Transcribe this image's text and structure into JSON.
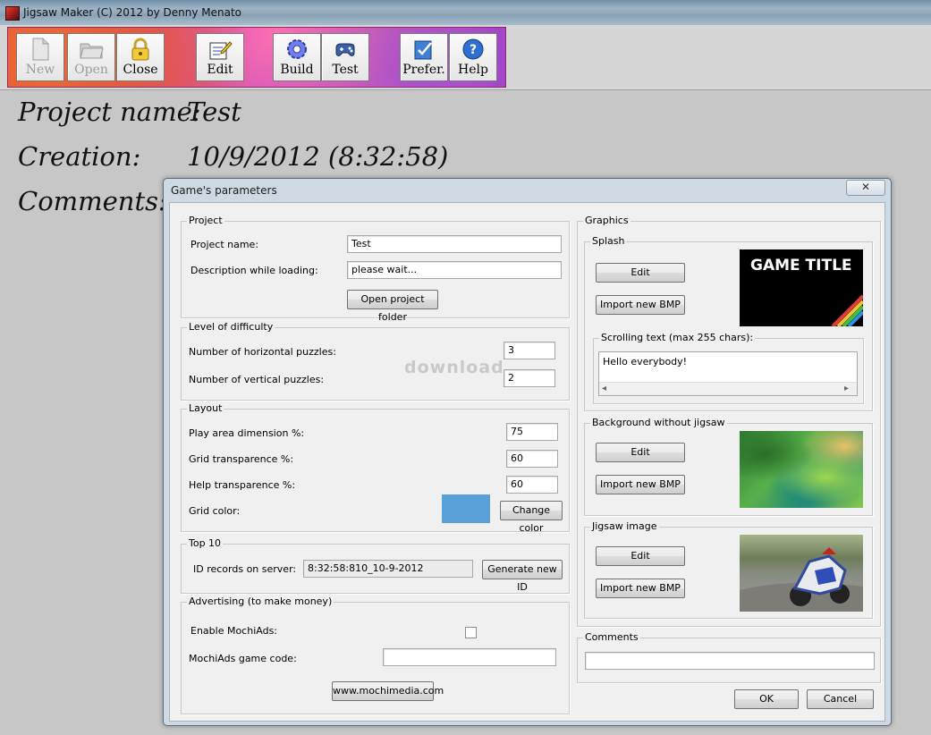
{
  "window": {
    "title": "Jigsaw Maker (C) 2012 by Denny Menato"
  },
  "toolbar": {
    "buttons": [
      {
        "label": "New",
        "icon": "new-document-icon",
        "enabled": false
      },
      {
        "label": "Open",
        "icon": "open-folder-icon",
        "enabled": false
      },
      {
        "label": "Close",
        "icon": "padlock-icon",
        "enabled": true
      },
      {
        "label": "Edit",
        "icon": "edit-pen-icon",
        "enabled": true
      },
      {
        "label": "Build",
        "icon": "gear-icon",
        "enabled": true
      },
      {
        "label": "Test",
        "icon": "gamepad-icon",
        "enabled": true
      },
      {
        "label": "Prefer.",
        "icon": "preferences-check-icon",
        "enabled": true
      },
      {
        "label": "Help",
        "icon": "help-question-icon",
        "enabled": true
      }
    ]
  },
  "main": {
    "project_label": "Project name:",
    "project_value": "Test",
    "creation_label": "Creation:",
    "creation_value": "10/9/2012 (8:32:58)",
    "comments_label": "Comments:"
  },
  "watermark": "download",
  "dialog": {
    "title": "Game's parameters",
    "close_glyph": "✕",
    "project": {
      "group_title": "Project",
      "name_label": "Project name:",
      "name_value": "Test",
      "desc_label": "Description while loading:",
      "desc_value": "please wait...",
      "open_folder_button": "Open project folder"
    },
    "difficulty": {
      "group_title": "Level of difficulty",
      "horizontal_label": "Number of horizontal puzzles:",
      "horizontal_value": "3",
      "vertical_label": "Number of vertical puzzles:",
      "vertical_value": "2"
    },
    "layout": {
      "group_title": "Layout",
      "play_area_label": "Play area dimension %:",
      "play_area_value": "75",
      "grid_transp_label": "Grid transparence %:",
      "grid_transp_value": "60",
      "help_transp_label": "Help transparence %:",
      "help_transp_value": "60",
      "grid_color_label": "Grid color:",
      "grid_color": "#5aa0d8",
      "change_color_button": "Change color"
    },
    "top10": {
      "group_title": "Top 10",
      "id_label": "ID records on server:",
      "id_value": "8:32:58:810_10-9-2012",
      "generate_button": "Generate new ID"
    },
    "advertising": {
      "group_title": "Advertising (to make money)",
      "enable_label": "Enable MochiAds:",
      "enable_checked": false,
      "code_label": "MochiAds game code:",
      "code_value": "",
      "website_button": "www.mochimedia.com"
    },
    "graphics": {
      "group_title": "Graphics",
      "splash": {
        "group_title": "Splash",
        "edit_button": "Edit",
        "import_button": "Import new BMP",
        "preview_text": "GAME TITLE",
        "scroll_group_title": "Scrolling text (max 255 chars):",
        "scroll_text": "Hello everybody!",
        "scroll_left": "◂",
        "scroll_right": "▸"
      },
      "background": {
        "group_title": "Background without jigsaw",
        "edit_button": "Edit",
        "import_button": "Import new BMP"
      },
      "jigsaw": {
        "group_title": "Jigsaw image",
        "edit_button": "Edit",
        "import_button": "Import new BMP"
      }
    },
    "comments": {
      "group_title": "Comments",
      "value": ""
    },
    "ok_button": "OK",
    "cancel_button": "Cancel"
  }
}
